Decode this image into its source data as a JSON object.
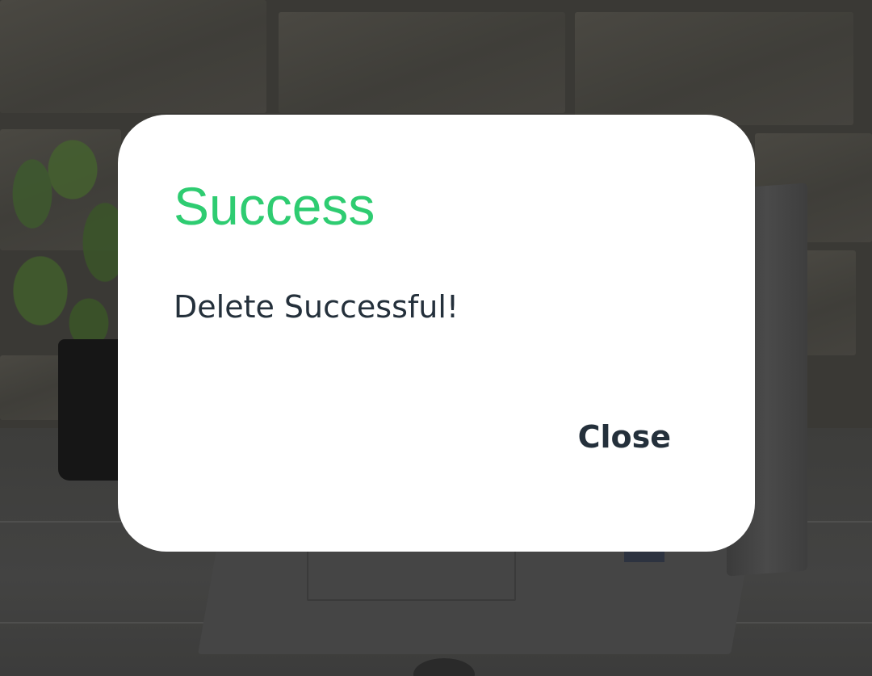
{
  "dialog": {
    "title": "Success",
    "message": "Delete Successful!",
    "close_label": "Close"
  },
  "colors": {
    "title_accent": "#2ecc71",
    "text": "#24303b",
    "dialog_background": "#ffffff"
  }
}
